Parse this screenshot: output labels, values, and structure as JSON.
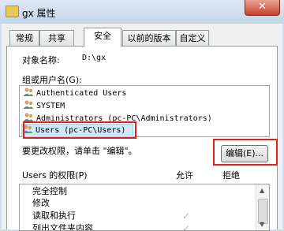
{
  "window": {
    "title": "gx 属性",
    "close_glyph": "✕"
  },
  "tabs": [
    {
      "label": "常规"
    },
    {
      "label": "共享"
    },
    {
      "label": "安全",
      "active": true
    },
    {
      "label": "以前的版本"
    },
    {
      "label": "自定义"
    }
  ],
  "object": {
    "label": "对象名称:",
    "value": "D:\\gx"
  },
  "groups": {
    "label": "组或用户名(G):",
    "items": [
      {
        "name": "Authenticated Users"
      },
      {
        "name": "SYSTEM"
      },
      {
        "name": "Administrators (pc-PC\\Administrators)"
      },
      {
        "name": "Users (pc-PC\\Users)",
        "selected": true
      }
    ]
  },
  "change_hint": "要更改权限，请单击 \"编辑\"。",
  "edit_button": "编辑(E)...",
  "permissions": {
    "label": "Users 的权限(P)",
    "allow_header": "允许",
    "deny_header": "拒绝",
    "rows": [
      {
        "name": "完全控制",
        "allow": false
      },
      {
        "name": "修改",
        "allow": false
      },
      {
        "name": "读取和执行",
        "allow": true
      },
      {
        "name": "列出文件夹内容",
        "allow": true
      }
    ],
    "check_glyph": "✓"
  },
  "colors": {
    "highlight_red": "#e0201a",
    "selection": "#cde8ff"
  }
}
